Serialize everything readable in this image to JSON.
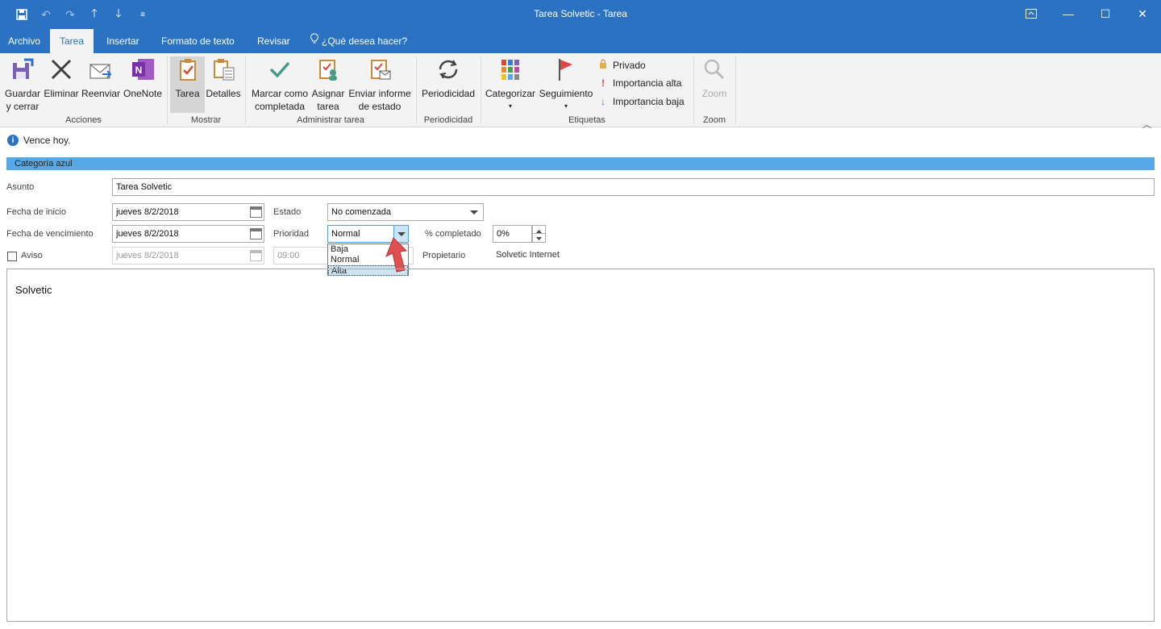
{
  "window": {
    "title": "Tarea Solvetic  -  Tarea",
    "controls": [
      "restore-ribbon",
      "minimize",
      "maximize",
      "close"
    ]
  },
  "tabs": [
    "Archivo",
    "Tarea",
    "Insertar",
    "Formato de texto",
    "Revisar",
    "¿Qué desea hacer?"
  ],
  "active_tab": "Tarea",
  "ribbon": {
    "groups": [
      {
        "label": "Acciones"
      },
      {
        "label": "Mostrar"
      },
      {
        "label": "Administrar tarea"
      },
      {
        "label": "Periodicidad"
      },
      {
        "label": "Etiquetas"
      },
      {
        "label": "Zoom"
      }
    ],
    "buttons": {
      "guardar": [
        "Guardar",
        "y cerrar"
      ],
      "eliminar": "Eliminar",
      "reenviar": "Reenviar",
      "onenote": "OneNote",
      "tarea": "Tarea",
      "detalles": "Detalles",
      "marcar": [
        "Marcar como",
        "completada"
      ],
      "asignar": [
        "Asignar",
        "tarea"
      ],
      "enviar": [
        "Enviar informe",
        "de estado"
      ],
      "periodicidad": "Periodicidad",
      "categorizar": "Categorizar",
      "seguimiento": "Seguimiento",
      "privado": "Privado",
      "importancia_alta": "Importancia alta",
      "importancia_baja": "Importancia baja",
      "zoom": "Zoom"
    },
    "colors": {
      "accent": "#2b72c2",
      "category": "#55a9e8",
      "flag": "#e04545",
      "check": "#4a9a8a"
    }
  },
  "form": {
    "info": "Vence hoy.",
    "category": "Categoría azul",
    "subject_label": "Asunto",
    "subject_value": "Tarea Solvetic",
    "start_label": "Fecha de inicio",
    "start_value": "jueves 8/2/2018",
    "due_label": "Fecha de vencimiento",
    "due_value": "jueves 8/2/2018",
    "reminder_label": "Aviso",
    "reminder_date": "jueves 8/2/2018",
    "reminder_time": "09:00",
    "status_label": "Estado",
    "status_value": "No comenzada",
    "priority_label": "Prioridad",
    "priority_value": "Normal",
    "priority_options": [
      "Baja",
      "Normal",
      "Alta"
    ],
    "priority_highlighted": "Alta",
    "percent_label": "% completado",
    "percent_value": "0%",
    "owner_label": "Propietario",
    "owner_value": "Solvetic Internet",
    "body_text": "Solvetic"
  }
}
